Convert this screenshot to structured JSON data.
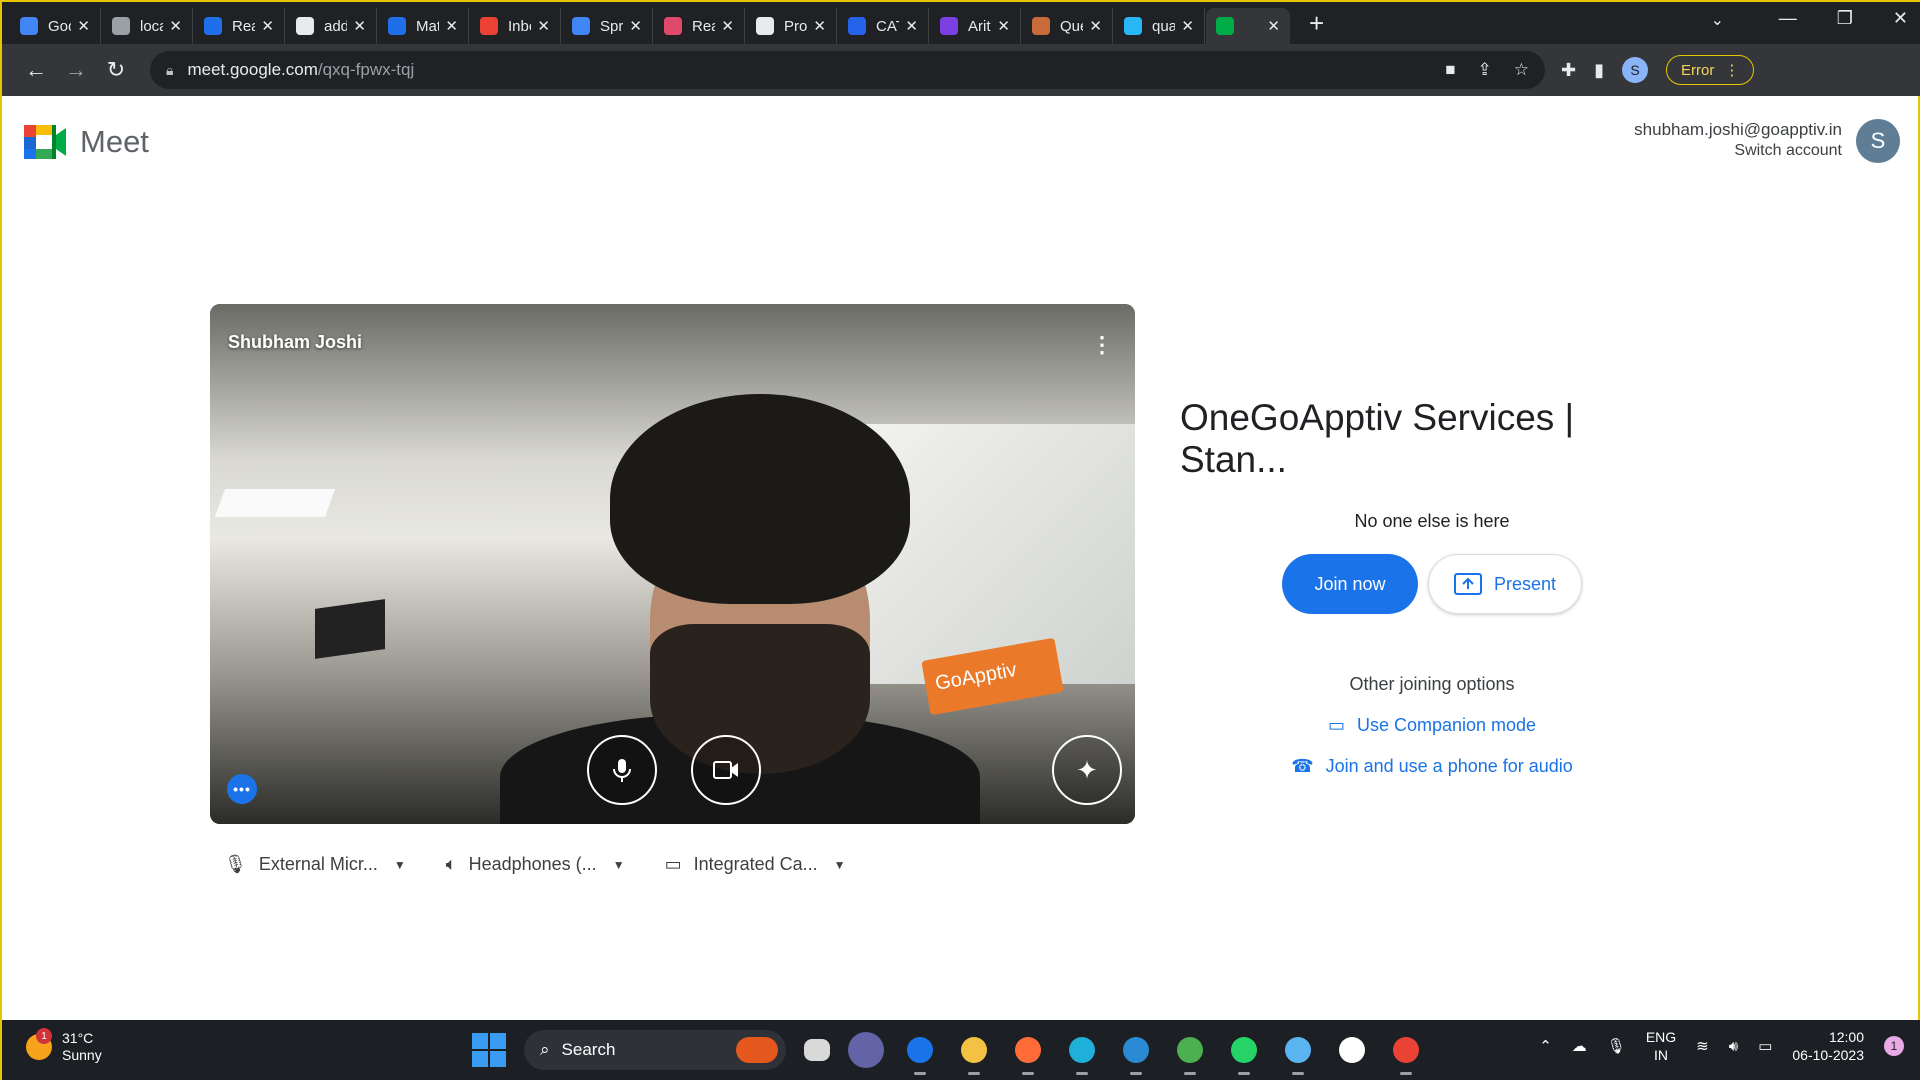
{
  "browser": {
    "tabs": [
      {
        "title": "Goo",
        "color": "#4285f4",
        "icon": "google-icon"
      },
      {
        "title": "loca",
        "color": "#9aa0a6",
        "icon": "globe-icon"
      },
      {
        "title": "Rea",
        "color": "#1f6feb",
        "icon": "mui-icon"
      },
      {
        "title": "add",
        "color": "#e8eaed",
        "icon": "github-icon"
      },
      {
        "title": "Mat",
        "color": "#1f6feb",
        "icon": "mui-icon"
      },
      {
        "title": "Inbo",
        "color": "#ea4335",
        "icon": "gmail-icon"
      },
      {
        "title": "Spri",
        "color": "#4285f4",
        "icon": "google-icon"
      },
      {
        "title": "Rea",
        "color": "#e04a6a",
        "icon": "react-icon"
      },
      {
        "title": "Proc",
        "color": "#e8eaed",
        "icon": "document-icon"
      },
      {
        "title": "CAT",
        "color": "#2563eb",
        "icon": "cat-icon"
      },
      {
        "title": "Arith",
        "color": "#7b3fe4",
        "icon": "book-icon"
      },
      {
        "title": "Que",
        "color": "#c96a3b",
        "icon": "avatar-icon"
      },
      {
        "title": "qua",
        "color": "#29b6f6",
        "icon": "stripes-icon"
      },
      {
        "title": "",
        "color": "#00ac47",
        "icon": "meet-icon",
        "active": true
      }
    ],
    "url_host": "meet.google.com",
    "url_path": "/qxq-fpwx-tqj",
    "error_label": "Error",
    "profile_initial": "S"
  },
  "meet": {
    "brand": "Meet",
    "account_email": "shubham.joshi@goapptiv.in",
    "switch_account": "Switch account",
    "avatar_initial": "S",
    "participant_name": "Shubham Joshi",
    "banner_text": "GoApptiv",
    "meeting_title": "OneGoApptiv Services | Stan...",
    "no_one_here": "No one else is here",
    "join_now": "Join now",
    "present": "Present",
    "other_options": "Other joining options",
    "companion_mode": "Use Companion mode",
    "phone_audio": "Join and use a phone for audio",
    "devices": {
      "mic": "External Micr...",
      "speaker": "Headphones (...",
      "camera": "Integrated Ca..."
    }
  },
  "taskbar": {
    "weather_temp": "31°C",
    "weather_desc": "Sunny",
    "weather_badge": "1",
    "search": "Search",
    "lang_top": "ENG",
    "lang_bottom": "IN",
    "time": "12:00",
    "date": "06-10-2023",
    "notifications": "1",
    "apps": [
      {
        "name": "chrome-icon",
        "color": "#1a73e8",
        "running": true
      },
      {
        "name": "file-explorer-icon",
        "color": "#f3c242",
        "running": true
      },
      {
        "name": "postman-icon",
        "color": "#ff6c37",
        "running": true
      },
      {
        "name": "edge-icon",
        "color": "#1fb0d9",
        "running": true
      },
      {
        "name": "vscode-icon",
        "color": "#2a8ad4",
        "running": true
      },
      {
        "name": "chrome-icon",
        "color": "#4caf50",
        "running": true
      },
      {
        "name": "whatsapp-icon",
        "color": "#25d366",
        "running": true
      },
      {
        "name": "notepad-icon",
        "color": "#5ab4f0",
        "running": true
      },
      {
        "name": "mongodb-icon",
        "color": "#ffffff",
        "running": false
      },
      {
        "name": "chrome-icon",
        "color": "#ea4335",
        "running": true
      }
    ]
  }
}
